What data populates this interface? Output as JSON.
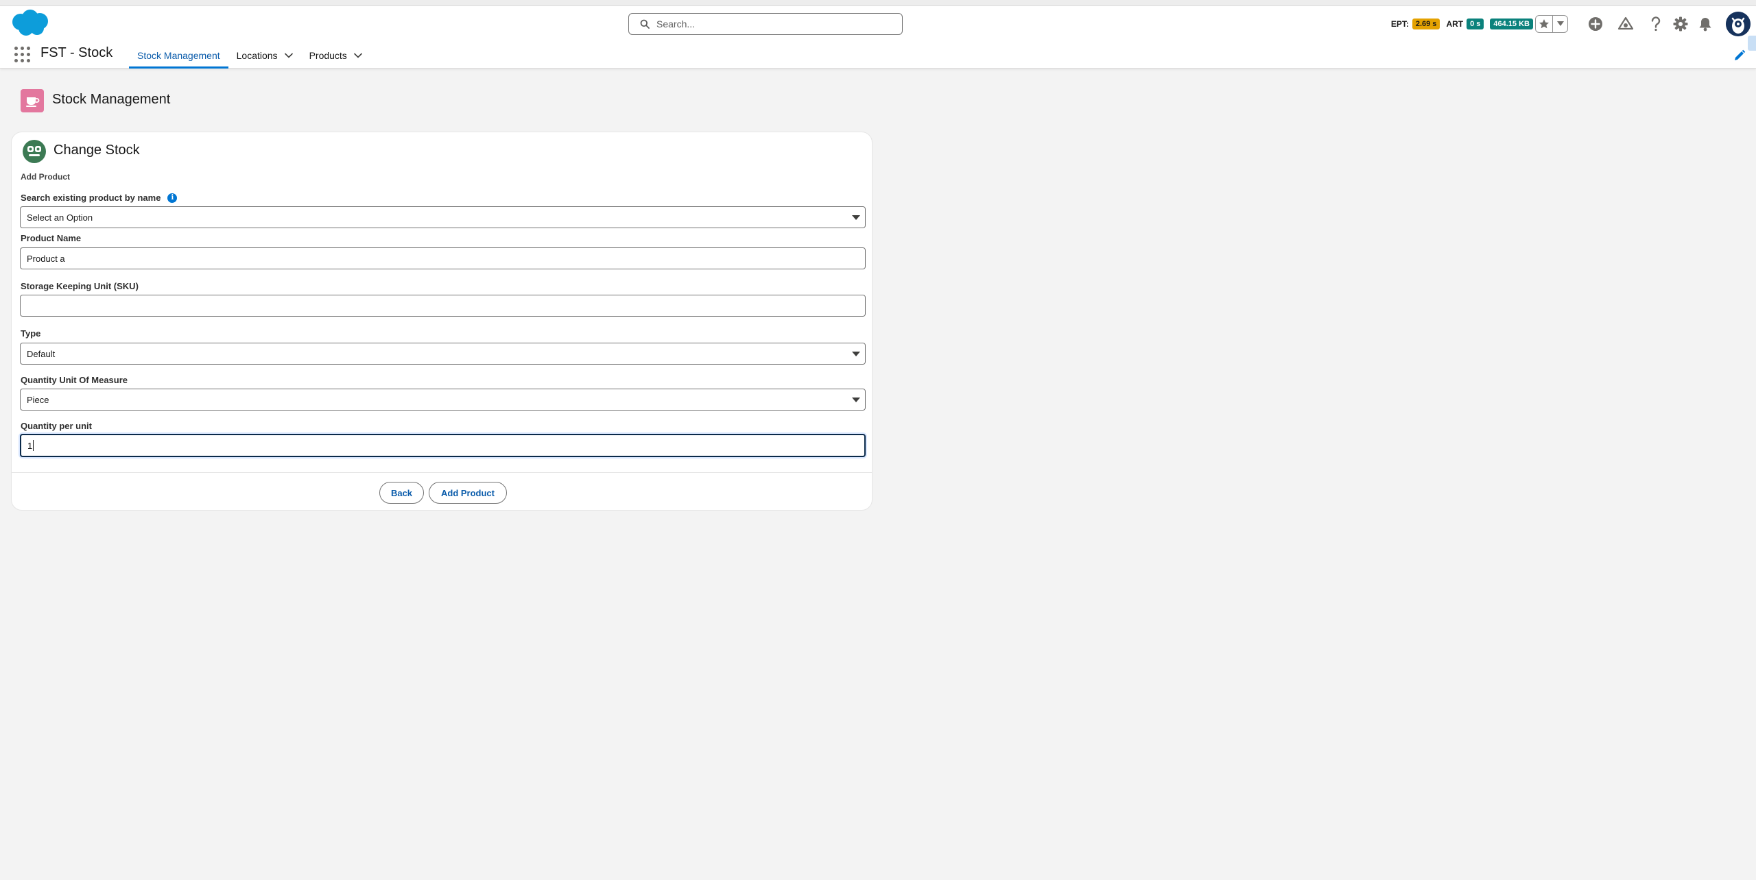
{
  "header": {
    "search_placeholder": "Search...",
    "metrics": [
      {
        "label": "EPT:",
        "value": "2.69 s"
      },
      {
        "label": "ART",
        "value": "0 s"
      },
      {
        "value": "464.15 KB"
      }
    ]
  },
  "nav": {
    "app_name": "FST - Stock",
    "tabs": [
      {
        "label": "Stock Management",
        "active": true
      },
      {
        "label": "Locations",
        "has_menu": true
      },
      {
        "label": "Products",
        "has_menu": true
      }
    ]
  },
  "page": {
    "title": "Stock Management"
  },
  "card": {
    "title": "Change Stock",
    "section": "Add Product",
    "fields": {
      "search_product": {
        "label": "Search existing product by name",
        "value": "Select an Option"
      },
      "product_name": {
        "label": "Product Name",
        "value": "Product a"
      },
      "sku": {
        "label": "Storage Keeping Unit (SKU)",
        "value": ""
      },
      "type": {
        "label": "Type",
        "value": "Default"
      },
      "uom": {
        "label": "Quantity Unit Of Measure",
        "value": "Piece"
      },
      "qty_per_unit": {
        "label": "Quantity per unit",
        "value": "1"
      }
    },
    "buttons": {
      "back": "Back",
      "add_product": "Add Product"
    }
  },
  "colors": {
    "brand_blue": "#0176d3",
    "link_blue": "#0b5cab",
    "ept_badge": "#e4a201",
    "teal_badge": "#0b827c",
    "page_icon": "#e3779e",
    "card_icon": "#3c7a54"
  }
}
